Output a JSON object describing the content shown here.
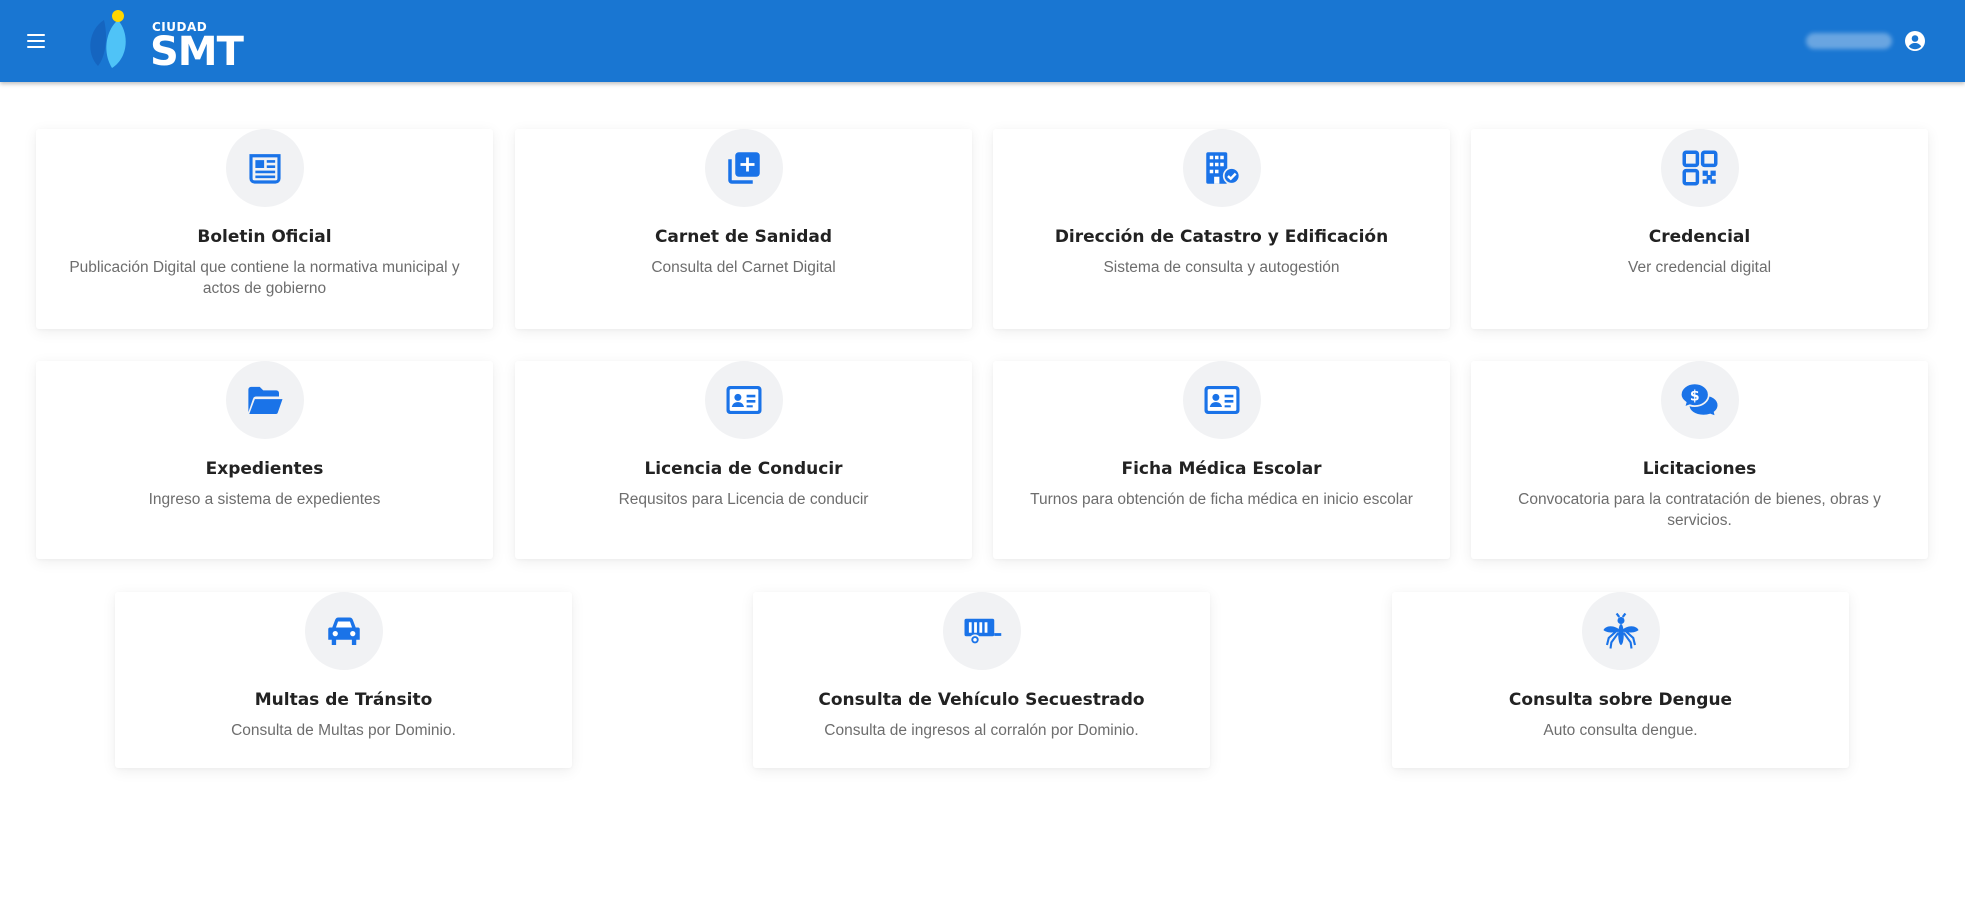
{
  "header": {
    "logo_small": "CIUDAD",
    "logo_big": "SMT",
    "colors": {
      "bar": "#1976d2",
      "logo_light": "#4fc3f7",
      "logo_dot": "#ffd600"
    }
  },
  "cards": [
    {
      "title": "Boletin Oficial",
      "desc": "Publicación Digital que contiene la normativa municipal y actos de gobierno",
      "icon": "newspaper-icon"
    },
    {
      "title": "Carnet de Sanidad",
      "desc": "Consulta del Carnet Digital",
      "icon": "add-library-icon"
    },
    {
      "title": "Dirección de Catastro y Edificación",
      "desc": "Sistema de consulta y autogestión",
      "icon": "building-check-icon"
    },
    {
      "title": "Credencial",
      "desc": "Ver credencial digital",
      "icon": "qr-code-icon"
    },
    {
      "title": "Expedientes",
      "desc": "Ingreso a sistema de expedientes",
      "icon": "folder-open-icon"
    },
    {
      "title": "Licencia de Conducir",
      "desc": "Requsitos para Licencia de conducir",
      "icon": "id-card-icon"
    },
    {
      "title": "Ficha Médica Escolar",
      "desc": "Turnos para obtención de ficha médica en inicio escolar",
      "icon": "id-card-icon"
    },
    {
      "title": "Licitaciones",
      "desc": "Convocatoria para la contratación de bienes, obras y servicios.",
      "icon": "money-chat-icon"
    },
    {
      "title": "Multas de Tránsito",
      "desc": "Consulta de Multas por Dominio.",
      "icon": "car-icon"
    },
    {
      "title": "Consulta de Vehículo Secuestrado",
      "desc": "Consulta de ingresos al corralón por Dominio.",
      "icon": "rv-trailer-icon"
    },
    {
      "title": "Consulta sobre Dengue",
      "desc": "Auto consulta dengue.",
      "icon": "mosquito-icon"
    }
  ],
  "accent_color": "#1a73e8"
}
